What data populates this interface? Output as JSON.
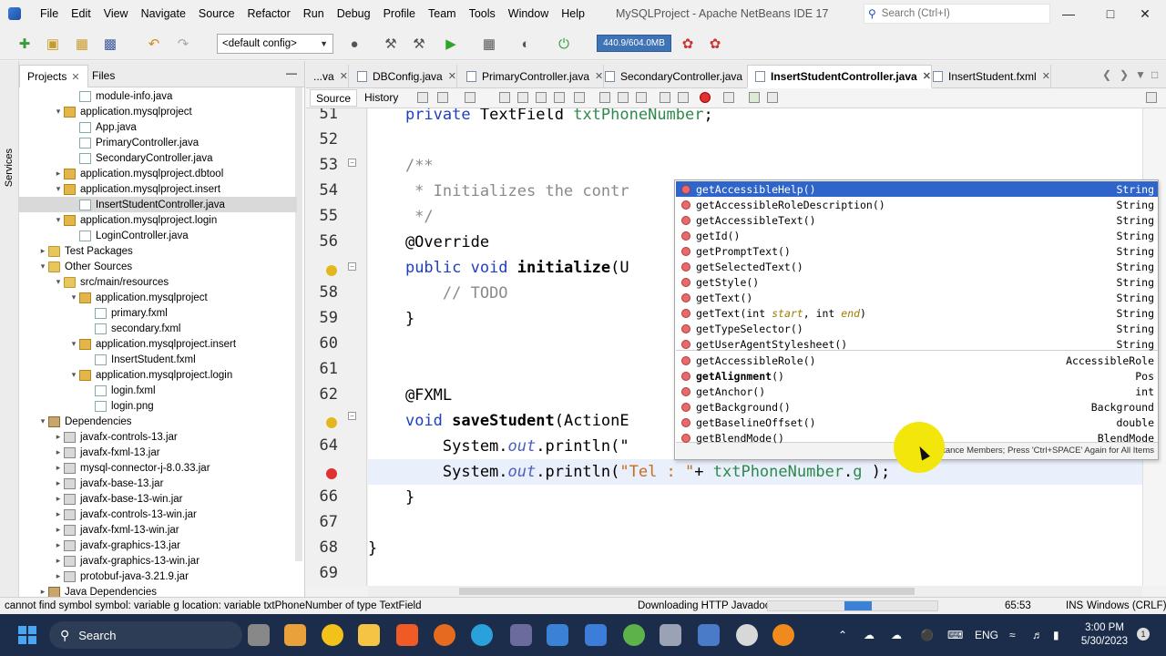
{
  "window": {
    "title": "MySQLProject - Apache NetBeans IDE 17",
    "search_placeholder": "Search (Ctrl+I)"
  },
  "menu": [
    "File",
    "Edit",
    "View",
    "Navigate",
    "Source",
    "Refactor",
    "Run",
    "Debug",
    "Profile",
    "Team",
    "Tools",
    "Window",
    "Help"
  ],
  "toolbar": {
    "config": "<default config>",
    "memory": "440.9/604.0MB"
  },
  "side_strip": {
    "services": "Services"
  },
  "project_panel": {
    "tabs": [
      "Projects",
      "Files"
    ],
    "tree": [
      {
        "label": "module-info.java",
        "indent": 4,
        "icon": "file",
        "toggle": ""
      },
      {
        "label": "application.mysqlproject",
        "indent": 3,
        "icon": "pkg",
        "toggle": "▾"
      },
      {
        "label": "App.java",
        "indent": 4,
        "icon": "file",
        "toggle": ""
      },
      {
        "label": "PrimaryController.java",
        "indent": 4,
        "icon": "file",
        "toggle": ""
      },
      {
        "label": "SecondaryController.java",
        "indent": 4,
        "icon": "file",
        "toggle": ""
      },
      {
        "label": "application.mysqlproject.dbtool",
        "indent": 3,
        "icon": "pkg",
        "toggle": "▸"
      },
      {
        "label": "application.mysqlproject.insert",
        "indent": 3,
        "icon": "pkg",
        "toggle": "▾"
      },
      {
        "label": "InsertStudentController.java",
        "indent": 4,
        "icon": "file",
        "toggle": "",
        "selected": true
      },
      {
        "label": "application.mysqlproject.login",
        "indent": 3,
        "icon": "pkg",
        "toggle": "▾"
      },
      {
        "label": "LoginController.java",
        "indent": 4,
        "icon": "file",
        "toggle": ""
      },
      {
        "label": "Test Packages",
        "indent": 2,
        "icon": "folder",
        "toggle": "▸"
      },
      {
        "label": "Other Sources",
        "indent": 2,
        "icon": "folder",
        "toggle": "▾"
      },
      {
        "label": "src/main/resources",
        "indent": 3,
        "icon": "folder",
        "toggle": "▾"
      },
      {
        "label": "application.mysqlproject",
        "indent": 4,
        "icon": "pkg",
        "toggle": "▾"
      },
      {
        "label": "primary.fxml",
        "indent": 5,
        "icon": "file",
        "toggle": ""
      },
      {
        "label": "secondary.fxml",
        "indent": 5,
        "icon": "file",
        "toggle": ""
      },
      {
        "label": "application.mysqlproject.insert",
        "indent": 4,
        "icon": "pkg",
        "toggle": "▾"
      },
      {
        "label": "InsertStudent.fxml",
        "indent": 5,
        "icon": "file",
        "toggle": ""
      },
      {
        "label": "application.mysqlproject.login",
        "indent": 4,
        "icon": "pkg",
        "toggle": "▾"
      },
      {
        "label": "login.fxml",
        "indent": 5,
        "icon": "file",
        "toggle": ""
      },
      {
        "label": "login.png",
        "indent": 5,
        "icon": "file",
        "toggle": ""
      },
      {
        "label": "Dependencies",
        "indent": 2,
        "icon": "deps",
        "toggle": "▾"
      },
      {
        "label": "javafx-controls-13.jar",
        "indent": 3,
        "icon": "jar",
        "toggle": "▸"
      },
      {
        "label": "javafx-fxml-13.jar",
        "indent": 3,
        "icon": "jar",
        "toggle": "▸"
      },
      {
        "label": "mysql-connector-j-8.0.33.jar",
        "indent": 3,
        "icon": "jar",
        "toggle": "▸"
      },
      {
        "label": "javafx-base-13.jar",
        "indent": 3,
        "icon": "jar",
        "toggle": "▸"
      },
      {
        "label": "javafx-base-13-win.jar",
        "indent": 3,
        "icon": "jar",
        "toggle": "▸"
      },
      {
        "label": "javafx-controls-13-win.jar",
        "indent": 3,
        "icon": "jar",
        "toggle": "▸"
      },
      {
        "label": "javafx-fxml-13-win.jar",
        "indent": 3,
        "icon": "jar",
        "toggle": "▸"
      },
      {
        "label": "javafx-graphics-13.jar",
        "indent": 3,
        "icon": "jar",
        "toggle": "▸"
      },
      {
        "label": "javafx-graphics-13-win.jar",
        "indent": 3,
        "icon": "jar",
        "toggle": "▸"
      },
      {
        "label": "protobuf-java-3.21.9.jar",
        "indent": 3,
        "icon": "jar",
        "toggle": "▸"
      },
      {
        "label": "Java Dependencies",
        "indent": 2,
        "icon": "deps",
        "toggle": "▸"
      }
    ]
  },
  "editor_tabs": [
    {
      "label": "...va",
      "active": false
    },
    {
      "label": "DBConfig.java",
      "active": false
    },
    {
      "label": "PrimaryController.java",
      "active": false
    },
    {
      "label": "SecondaryController.java",
      "active": false
    },
    {
      "label": "InsertStudentController.java",
      "active": true
    },
    {
      "label": "InsertStudent.fxml",
      "active": false
    }
  ],
  "source_bar": {
    "source": "Source",
    "history": "History"
  },
  "code_lines": [
    {
      "n": "51",
      "html": "    <span class=\"kw\">private</span> TextField <span class=\"fld\">txtPhoneNumber</span>;"
    },
    {
      "n": "52",
      "html": ""
    },
    {
      "n": "53",
      "html": "    <span class=\"cm\">/**</span>"
    },
    {
      "n": "54",
      "html": "<span class=\"cm\">     * Initializes the contr</span>"
    },
    {
      "n": "55",
      "html": "<span class=\"cm\">     */</span>"
    },
    {
      "n": "56",
      "html": "    @Override"
    },
    {
      "n": "",
      "html": "    <span class=\"kw\">public void</span> <span class=\"bold\">initialize</span>(U"
    },
    {
      "n": "58",
      "html": "        <span class=\"cm\">// TODO</span>"
    },
    {
      "n": "59",
      "html": "    }"
    },
    {
      "n": "60",
      "html": ""
    },
    {
      "n": "61",
      "html": ""
    },
    {
      "n": "62",
      "html": "    @FXML"
    },
    {
      "n": "",
      "html": "    <span class=\"kw\">void</span> <span class=\"bold\">saveStudent</span>(ActionE"
    },
    {
      "n": "64",
      "html": "        System.<span class=\"it\">out</span>.println(\""
    },
    {
      "n": "",
      "html": "        System.<span class=\"it\">out</span>.println(<span class=\"str\">\"Tel : \"</span>+ <span class=\"fld\">txtPhoneNumber</span>.<span class=\"fld\">g</span> );",
      "current": true
    },
    {
      "n": "66",
      "html": "    }"
    },
    {
      "n": "67",
      "html": ""
    },
    {
      "n": "68",
      "html": "}"
    },
    {
      "n": "69",
      "html": ""
    }
  ],
  "autocomplete": {
    "items": [
      {
        "name": "getAccessibleHelp()",
        "params": "",
        "type": "String",
        "selected": true
      },
      {
        "name": "getAccessibleRoleDescription()",
        "params": "",
        "type": "String"
      },
      {
        "name": "getAccessibleText()",
        "params": "",
        "type": "String"
      },
      {
        "name": "getId()",
        "params": "",
        "type": "String"
      },
      {
        "name": "getPromptText()",
        "params": "",
        "type": "String"
      },
      {
        "name": "getSelectedText()",
        "params": "",
        "type": "String"
      },
      {
        "name": "getStyle()",
        "params": "",
        "type": "String"
      },
      {
        "name": "getText()",
        "params": "",
        "type": "String"
      },
      {
        "name": "getText(int <span class=\"p\">start</span>, int <span class=\"p\">end</span>)",
        "params": "",
        "type": "String"
      },
      {
        "name": "getTypeSelector()",
        "params": "",
        "type": "String"
      },
      {
        "name": "getUserAgentStylesheet()",
        "params": "",
        "type": "String"
      },
      {
        "name": "getAccessibleRole()",
        "params": "",
        "type": "AccessibleRole"
      },
      {
        "name": "<b>getAlignment</b>()",
        "params": "",
        "type": "Pos"
      },
      {
        "name": "getAnchor()",
        "params": "",
        "type": "int"
      },
      {
        "name": "getBackground()",
        "params": "",
        "type": "Background"
      },
      {
        "name": "getBaselineOffset()",
        "params": "",
        "type": "double"
      },
      {
        "name": "getBlendMode()",
        "params": "",
        "type": "BlendMode"
      }
    ],
    "footer": "Instance Members; Press 'Ctrl+SPACE' Again for All Items"
  },
  "status": {
    "message": "cannot find symbol  symbol:  variable g  location: variable txtPhoneNumber of type TextField",
    "task": "Downloading HTTP Javadoc",
    "position": "65:53",
    "insert_mode": "INS",
    "line_endings": "Windows (CRLF)"
  },
  "taskbar": {
    "search": "Search",
    "lang": "ENG",
    "time": "3:00 PM",
    "date": "5/30/2023",
    "notifications": "1"
  },
  "colors": {
    "accent": "#2f65ca",
    "taskbar": "#1b2d4a"
  }
}
